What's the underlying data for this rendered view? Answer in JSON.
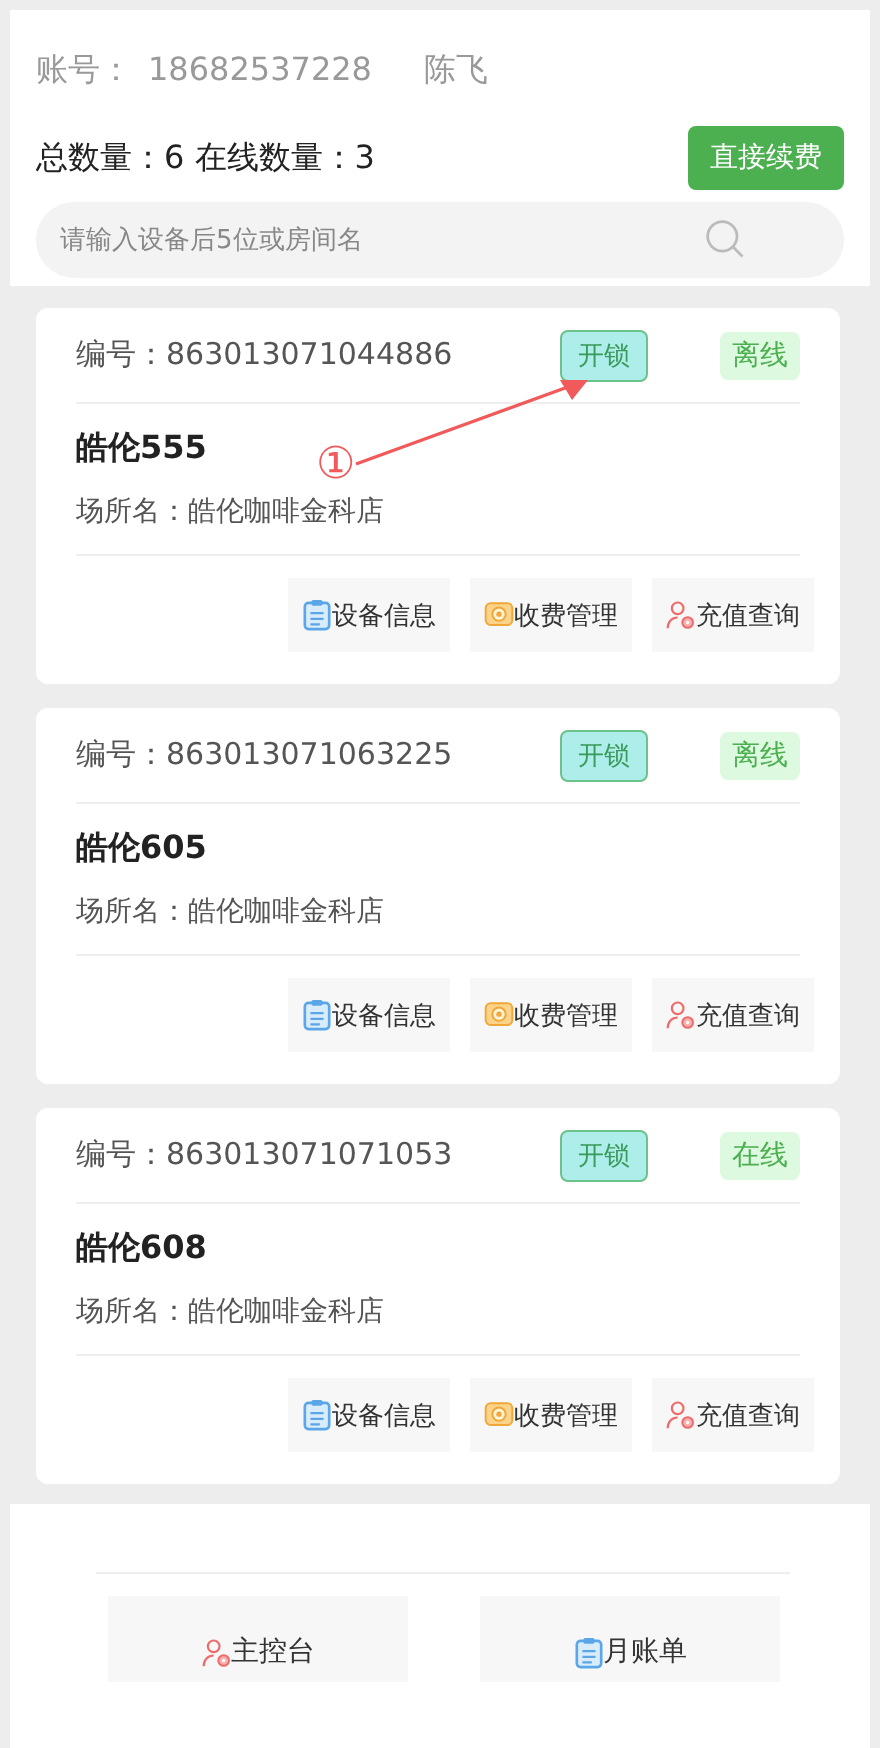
{
  "account": {
    "label": "账号：",
    "number": "18682537228",
    "name": "陈飞"
  },
  "summary": {
    "text": "总数量：6 在线数量：3",
    "renew_button": "直接续费"
  },
  "search": {
    "placeholder": "请输入设备后5位或房间名"
  },
  "devices": [
    {
      "code": "编号：863013071044886",
      "unlock": "开锁",
      "status": "离线",
      "room": "皓伦555",
      "venue": "场所名：皓伦咖啡金科店",
      "actions": [
        "设备信息",
        "收费管理",
        "充值查询"
      ]
    },
    {
      "code": "编号：863013071063225",
      "unlock": "开锁",
      "status": "离线",
      "room": "皓伦605",
      "venue": "场所名：皓伦咖啡金科店",
      "actions": [
        "设备信息",
        "收费管理",
        "充值查询"
      ]
    },
    {
      "code": "编号：863013071071053",
      "unlock": "开锁",
      "status": "在线",
      "room": "皓伦608",
      "venue": "场所名：皓伦咖啡金科店",
      "actions": [
        "设备信息",
        "收费管理",
        "充值查询"
      ]
    }
  ],
  "annotation": {
    "marker": "①"
  },
  "bottom_nav": [
    {
      "label": "主控台",
      "kind": "console"
    },
    {
      "label": "月账单",
      "kind": "bill"
    }
  ]
}
